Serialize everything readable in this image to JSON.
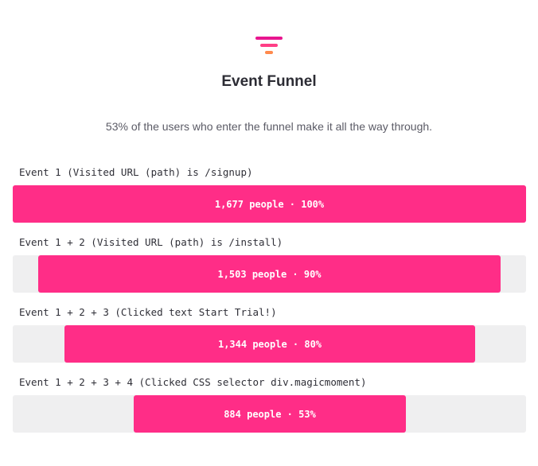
{
  "header": {
    "icon": "funnel-icon",
    "title": "Event Funnel",
    "subtitle": "53% of the users who enter the funnel make it all the way through."
  },
  "colors": {
    "bar": "#ff2d87",
    "track": "#efeff0",
    "icon_top": "#e8168f",
    "icon_mid": "#ff3f86",
    "icon_bottom": "#ff8a4d"
  },
  "chart_data": {
    "type": "bar",
    "orientation": "horizontal-funnel",
    "categories": [
      "Event 1 (Visited URL (path) is /signup)",
      "Event 1 + 2 (Visited URL (path) is /install)",
      "Event 1 + 2 + 3 (Clicked text Start Trial!)",
      "Event 1 + 2 + 3 + 4 (Clicked CSS selector div.magicmoment)"
    ],
    "values": [
      1677,
      1503,
      1344,
      884
    ],
    "percents": [
      100,
      90,
      80,
      53
    ],
    "bar_labels": [
      "1,677 people · 100%",
      "1,503 people · 90%",
      "1,344 people · 80%",
      "884 people · 53%"
    ]
  }
}
